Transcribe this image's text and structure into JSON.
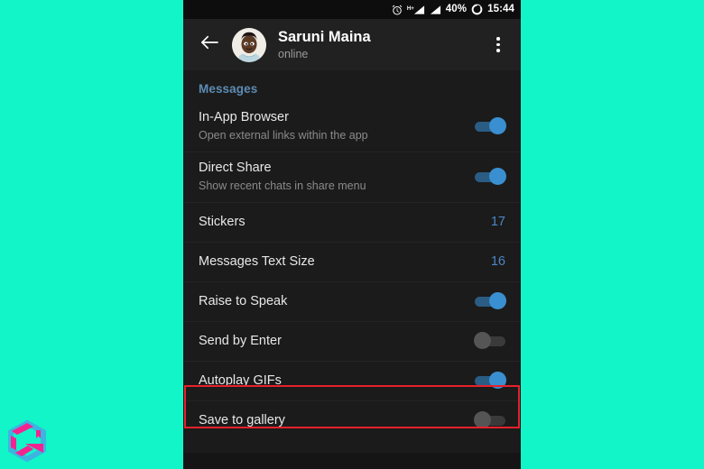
{
  "canvas": {
    "background_color": "#12f5c8",
    "logo_name": "hexagon-brand-logo",
    "logo_colors": {
      "magenta": "#f4238f",
      "blue": "#3bb5e0"
    }
  },
  "status_bar": {
    "alarm_icon": "alarm-clock-icon",
    "network_label": "H+",
    "signal_icon_1": "signal-bars-icon",
    "signal_icon_2": "signal-bars-icon",
    "battery_percent": "40%",
    "battery_icon": "battery-circle-icon",
    "time": "15:44"
  },
  "app_bar": {
    "back_icon": "back-arrow-icon",
    "avatar_name": "user-avatar",
    "title": "Saruni Maina",
    "subtitle": "online",
    "overflow_icon": "overflow-menu-icon"
  },
  "settings": {
    "section_title": "Messages",
    "accent_color": "#5d8cb3",
    "value_color": "#4a87c4",
    "highlight_color": "#e8202a",
    "rows": [
      {
        "label": "In-App Browser",
        "sub": "Open external links within the app",
        "control": "toggle",
        "state": "on",
        "highlighted": false
      },
      {
        "label": "Direct Share",
        "sub": "Show recent chats in share menu",
        "control": "toggle",
        "state": "on",
        "highlighted": false
      },
      {
        "label": "Stickers",
        "sub": "",
        "control": "value",
        "value": "17",
        "highlighted": false
      },
      {
        "label": "Messages Text Size",
        "sub": "",
        "control": "value",
        "value": "16",
        "highlighted": false
      },
      {
        "label": "Raise to Speak",
        "sub": "",
        "control": "toggle",
        "state": "on",
        "highlighted": false
      },
      {
        "label": "Send by Enter",
        "sub": "",
        "control": "toggle",
        "state": "off",
        "highlighted": false
      },
      {
        "label": "Autoplay GIFs",
        "sub": "",
        "control": "toggle",
        "state": "on",
        "highlighted": false
      },
      {
        "label": "Save to gallery",
        "sub": "",
        "control": "toggle",
        "state": "off",
        "highlighted": true
      }
    ]
  }
}
